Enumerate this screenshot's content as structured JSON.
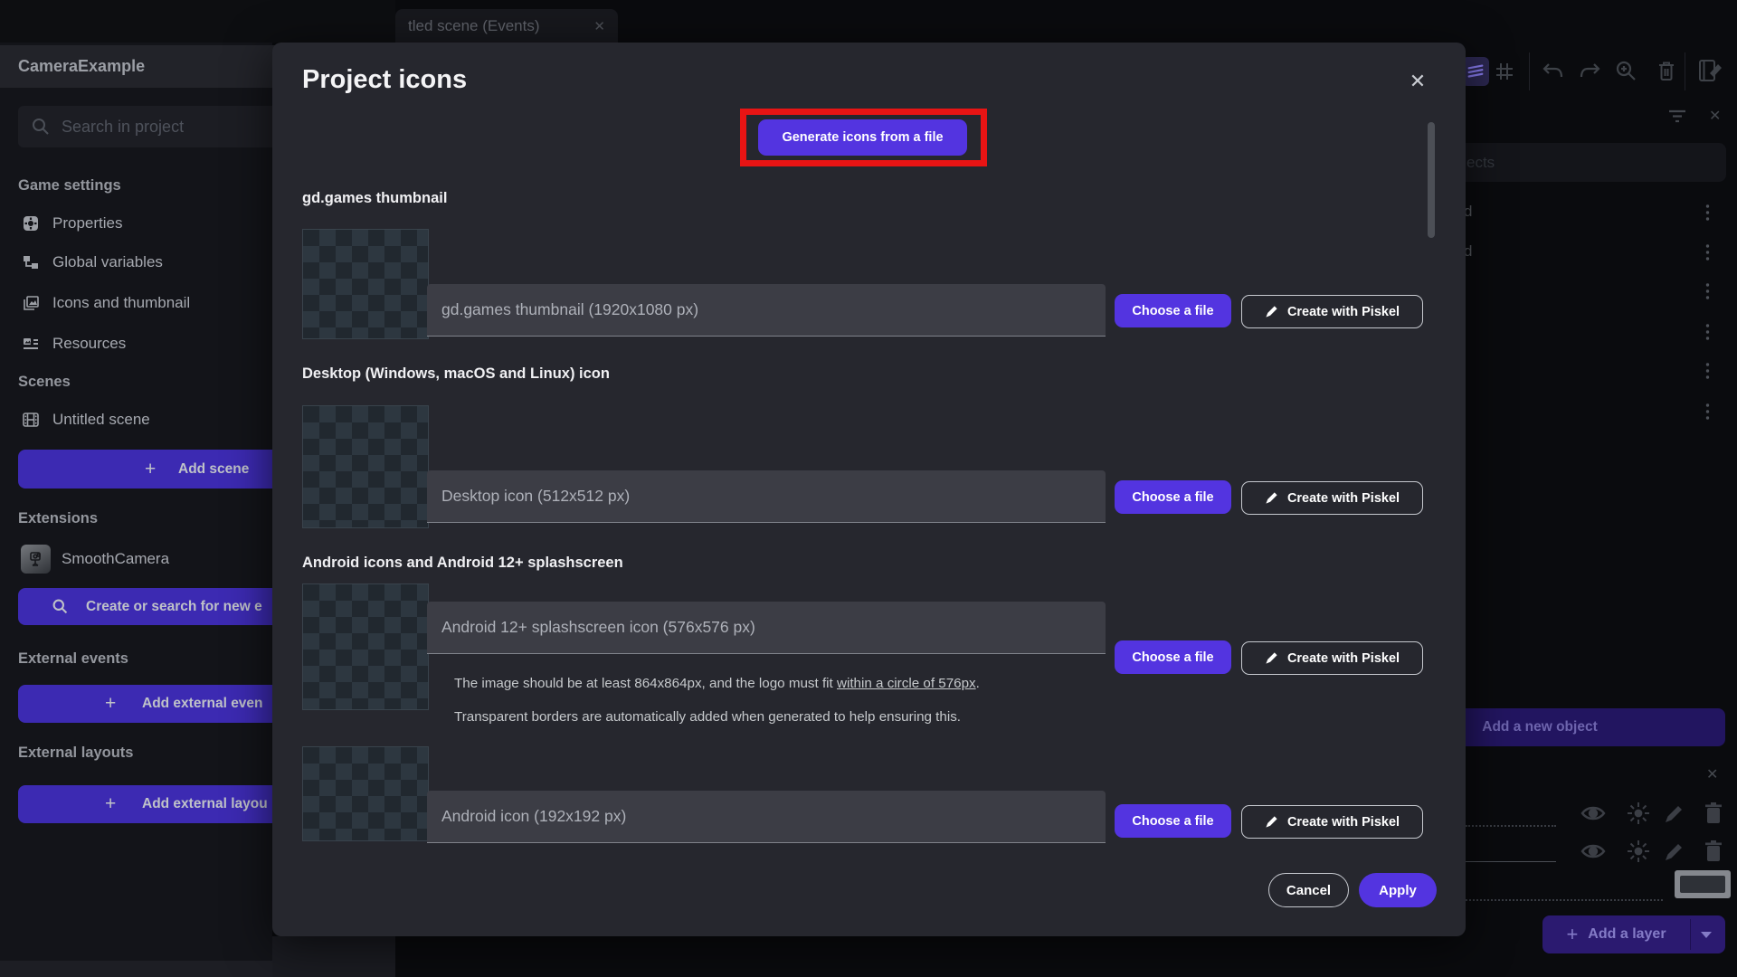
{
  "colors": {
    "accent": "#5334e0",
    "accent_dim": "#3c2ab2",
    "annotation_red": "#e81414"
  },
  "tab": {
    "label": "tled scene (Events)"
  },
  "sidebar": {
    "project_name": "CameraExample",
    "search_placeholder": "Search in project",
    "sections": [
      {
        "label": "Game settings",
        "items": [
          {
            "label": "Properties"
          },
          {
            "label": "Global variables"
          },
          {
            "label": "Icons and thumbnail"
          },
          {
            "label": "Resources"
          }
        ]
      },
      {
        "label": "Scenes",
        "items": [
          {
            "label": "Untitled scene"
          }
        ],
        "button": "Add scene"
      },
      {
        "label": "Extensions",
        "items": [
          {
            "label": "SmoothCamera"
          }
        ],
        "button": "Create or search for new e"
      },
      {
        "label": "External events",
        "button": "Add external even"
      },
      {
        "label": "External layouts",
        "button": "Add external layou"
      }
    ]
  },
  "objects_panel": {
    "search_fragment": "ects",
    "row_fragments": [
      "d",
      "d",
      "",
      "",
      "",
      ""
    ],
    "add_button": "Add a new object"
  },
  "layers_panel": {
    "add_button": "Add a layer"
  },
  "modal": {
    "title": "Project icons",
    "generate_button": "Generate icons from a file",
    "choose_label": "Choose a file",
    "piskel_label": "Create with Piskel",
    "sections": [
      {
        "label": "gd.games thumbnail",
        "hint": "gd.games thumbnail (1920x1080 px)"
      },
      {
        "label": "Desktop (Windows, macOS and Linux) icon",
        "hint": "Desktop icon (512x512 px)"
      },
      {
        "label": "Android icons and Android 12+ splashscreen",
        "hint": "Android 12+ splashscreen icon (576x576 px)",
        "helper_line1_pre": "The image should be at least 864x864px, and the logo must fit ",
        "helper_line1_underlined": "within a circle of 576px",
        "helper_line1_post": ".",
        "helper_line2": "Transparent borders are automatically added when generated to help ensuring this."
      },
      {
        "hint": "Android icon (192x192 px)"
      }
    ],
    "cancel_button": "Cancel",
    "apply_button": "Apply"
  }
}
